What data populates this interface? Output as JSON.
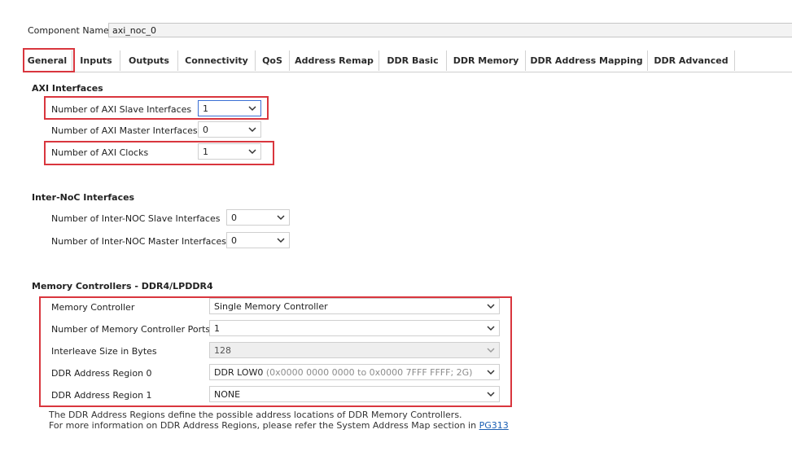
{
  "component": {
    "label": "Component Name",
    "value": "axi_noc_0"
  },
  "tabs": [
    {
      "label": "General"
    },
    {
      "label": "Inputs"
    },
    {
      "label": "Outputs"
    },
    {
      "label": "Connectivity"
    },
    {
      "label": "QoS"
    },
    {
      "label": "Address Remap"
    },
    {
      "label": "DDR Basic"
    },
    {
      "label": "DDR Memory"
    },
    {
      "label": "DDR Address Mapping"
    },
    {
      "label": "DDR Advanced"
    }
  ],
  "axi": {
    "title": "AXI Interfaces",
    "slave_label": "Number of AXI Slave Interfaces",
    "slave_value": "1",
    "master_label": "Number of AXI Master Interfaces",
    "master_value": "0",
    "clocks_label": "Number of AXI Clocks",
    "clocks_value": "1"
  },
  "internoc": {
    "title": "Inter-NoC Interfaces",
    "slave_label": "Number of Inter-NOC Slave Interfaces",
    "slave_value": "0",
    "master_label": "Number of Inter-NOC Master Interfaces",
    "master_value": "0"
  },
  "memctrl": {
    "title": "Memory Controllers - DDR4/LPDDR4",
    "mc_label": "Memory Controller",
    "mc_value": "Single Memory Controller",
    "ports_label": "Number of Memory Controller Ports",
    "ports_value": "1",
    "interleave_label": "Interleave Size in Bytes",
    "interleave_value": "128",
    "region0_label": "DDR Address Region 0",
    "region0_value": "DDR LOW0",
    "region0_detail": " (0x0000 0000 0000 to 0x0000 7FFF FFFF; 2G)",
    "region1_label": "DDR Address Region 1",
    "region1_value": "NONE",
    "note_line1": "The DDR Address Regions define the possible address locations of DDR Memory Controllers.",
    "note_line2": "For more information on DDR Address Regions, please refer the System Address Map section in ",
    "note_link": "PG313"
  },
  "colors": {
    "highlight": "#d9363e",
    "focus": "#3b6fd4",
    "link": "#1a5fb4"
  }
}
